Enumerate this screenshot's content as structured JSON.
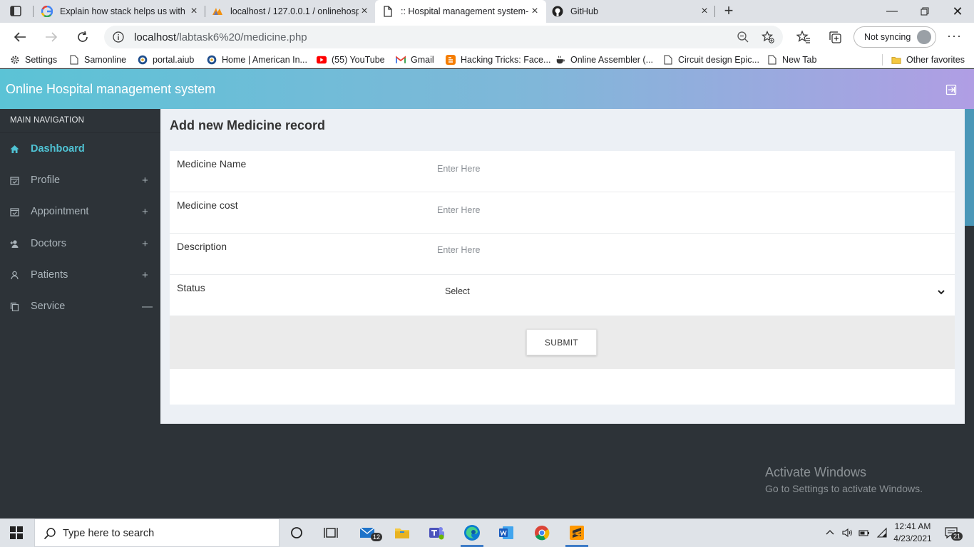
{
  "browser": {
    "tabs": [
      {
        "title": "Explain how stack helps us with p",
        "icon": "google-icon"
      },
      {
        "title": "localhost / 127.0.0.1 / onlinehosp",
        "icon": "phpmyadmin-icon"
      },
      {
        "title": ":: Hospital management system-",
        "icon": "page-icon"
      },
      {
        "title": "GitHub",
        "icon": "github-icon"
      }
    ],
    "url_host": "localhost",
    "url_path": "/labtask6%20/medicine.php",
    "sync_label": "Not syncing",
    "more_label": "···"
  },
  "bookmarks": [
    {
      "label": "Settings",
      "icon": "gear-icon"
    },
    {
      "label": "Samonline",
      "icon": "page-icon"
    },
    {
      "label": "portal.aiub",
      "icon": "aiub-icon"
    },
    {
      "label": "Home | American In...",
      "icon": "aiub-icon"
    },
    {
      "label": "(55) YouTube",
      "icon": "youtube-icon"
    },
    {
      "label": "Gmail",
      "icon": "gmail-icon"
    },
    {
      "label": "Hacking Tricks: Face...",
      "icon": "blogger-icon"
    },
    {
      "label": "Online Assembler (...",
      "icon": "coffee-icon"
    },
    {
      "label": "Circuit design Epic...",
      "icon": "page-icon"
    },
    {
      "label": "New Tab",
      "icon": "page-icon"
    },
    {
      "label": "Other favorites",
      "icon": "folder-icon"
    }
  ],
  "app": {
    "brand": "Online Hospital management system"
  },
  "sidebar": {
    "header": "MAIN NAVIGATION",
    "items": [
      {
        "label": "Dashboard",
        "toggle": "",
        "icon": "home-icon",
        "active": true
      },
      {
        "label": "Profile",
        "toggle": "+",
        "icon": "calendar-check-icon"
      },
      {
        "label": "Appointment",
        "toggle": "+",
        "icon": "calendar-check-icon"
      },
      {
        "label": "Doctors",
        "toggle": "+",
        "icon": "user-plus-icon"
      },
      {
        "label": "Patients",
        "toggle": "+",
        "icon": "user-icon"
      },
      {
        "label": "Service",
        "toggle": "—",
        "icon": "copy-icon"
      }
    ]
  },
  "form": {
    "title": "Add new Medicine record",
    "fields": [
      {
        "label": "Medicine Name",
        "placeholder": "Enter Here",
        "value": ""
      },
      {
        "label": "Medicine cost",
        "placeholder": "Enter Here",
        "value": ""
      },
      {
        "label": "Description",
        "placeholder": "Enter Here",
        "value": ""
      }
    ],
    "status_label": "Status",
    "status_value": "Select",
    "submit_label": "SUBMIT"
  },
  "watermark": {
    "line1": "Activate Windows",
    "line2": "Go to Settings to activate Windows."
  },
  "taskbar": {
    "search_placeholder": "Type here to search",
    "mail_badge": "12",
    "time": "12:41 AM",
    "date": "4/23/2021",
    "notification_count": "21"
  },
  "colors": {
    "accent": "#4fc3d4",
    "sidebar_bg": "#2d3338",
    "header_gradient_start": "#5bc3d6",
    "header_gradient_end": "#b09ee4",
    "content_bg": "#ecf0f5"
  }
}
